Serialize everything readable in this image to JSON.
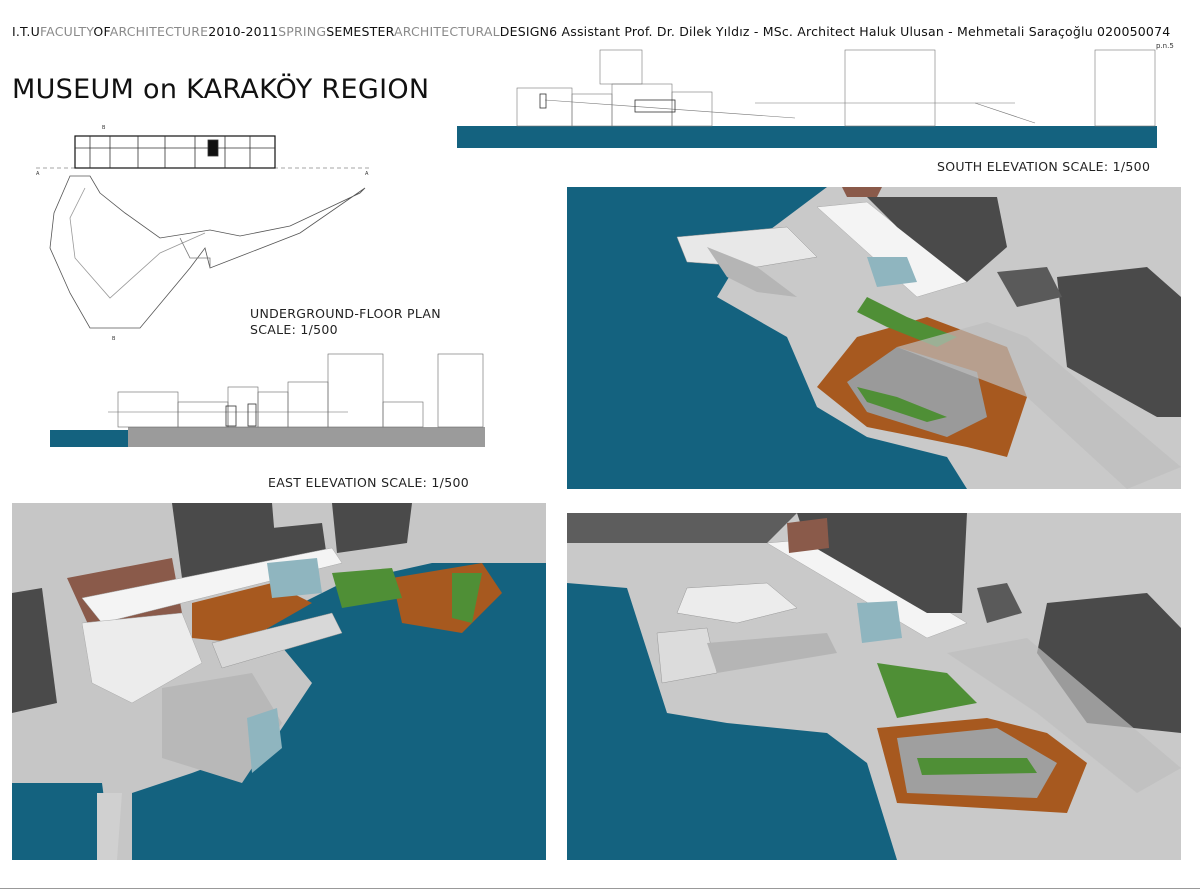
{
  "header": {
    "segments": [
      {
        "text": "I.T.U",
        "tone": "w"
      },
      {
        "text": "FACULTY",
        "tone": "g"
      },
      {
        "text": "OF",
        "tone": "w"
      },
      {
        "text": "ARCHITECTURE",
        "tone": "g"
      },
      {
        "text": "2010-2011",
        "tone": "w"
      },
      {
        "text": "SPRING",
        "tone": "g"
      },
      {
        "text": "SEMESTER",
        "tone": "w"
      },
      {
        "text": "ARCHITECTURAL",
        "tone": "g"
      },
      {
        "text": "DESIGN",
        "tone": "w"
      },
      {
        "text": "6 Assistant Prof. Dr. Dilek Yıldız - MSc. Architect Haluk Ulusan - Mehmetali Saraçoğlu 020050074",
        "tone": "w"
      }
    ],
    "page_number": "p.n.5"
  },
  "title": "MUSEUM on  KARAKÖY REGION",
  "labels": {
    "plan_line1": "UNDERGROUND-FLOOR PLAN",
    "plan_line2": "SCALE: 1/500",
    "east": "EAST ELEVATION SCALE: 1/500",
    "south": "SOUTH ELEVATION SCALE: 1/500"
  },
  "colors": {
    "water": "#14627f",
    "ground": "#cfcfcf",
    "deck": "#a7591f",
    "building_dark": "#4a4a4a",
    "roof_white": "#f4f4f4",
    "glass": "#8fb5bf",
    "tree": "#4f8f36",
    "brick": "#8a5a4a"
  }
}
